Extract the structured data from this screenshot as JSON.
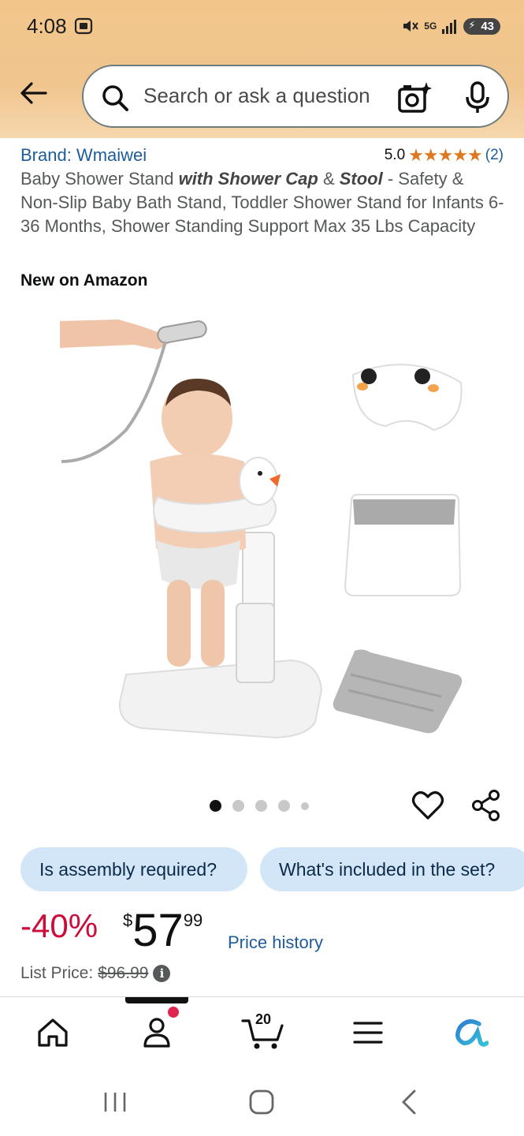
{
  "status_bar": {
    "time": "4:08",
    "network": "5G",
    "battery": "43"
  },
  "search": {
    "placeholder": "Search or ask a question"
  },
  "product": {
    "brand": "Brand: Wmaiwei",
    "rating": "5.0",
    "stars": "★★★★★",
    "rating_count": "(2)",
    "title_part1": "Baby Shower Stand ",
    "title_bold1": "with Shower Cap",
    "title_part2": " & ",
    "title_bold2": "Stool",
    "title_part3": " - Safety & Non-Slip Baby Bath Stand, Toddler Shower Stand for Infants 6-36 Months, Shower Standing Support Max 35 Lbs Capacity",
    "badge": "New on Amazon"
  },
  "carousel": {
    "image_count": 5,
    "active_index": 0
  },
  "chips": [
    "Is assembly required?",
    "What's included in the set?"
  ],
  "pricing": {
    "discount": "-40%",
    "currency_symbol": "$",
    "price_whole": "57",
    "price_fraction": "99",
    "price_history_link": "Price history",
    "list_price_label": "List Price:",
    "list_price_value": "$96.99"
  },
  "bottom_nav": {
    "cart_count": "20",
    "items": [
      "home-icon",
      "account-icon",
      "cart-icon",
      "menu-icon",
      "rufus-ai-icon"
    ]
  },
  "colors": {
    "header": "#f2c68b",
    "link": "#1f5c99",
    "discount": "#cc0c39",
    "chip": "#d3e6f8",
    "star": "#de7921"
  }
}
